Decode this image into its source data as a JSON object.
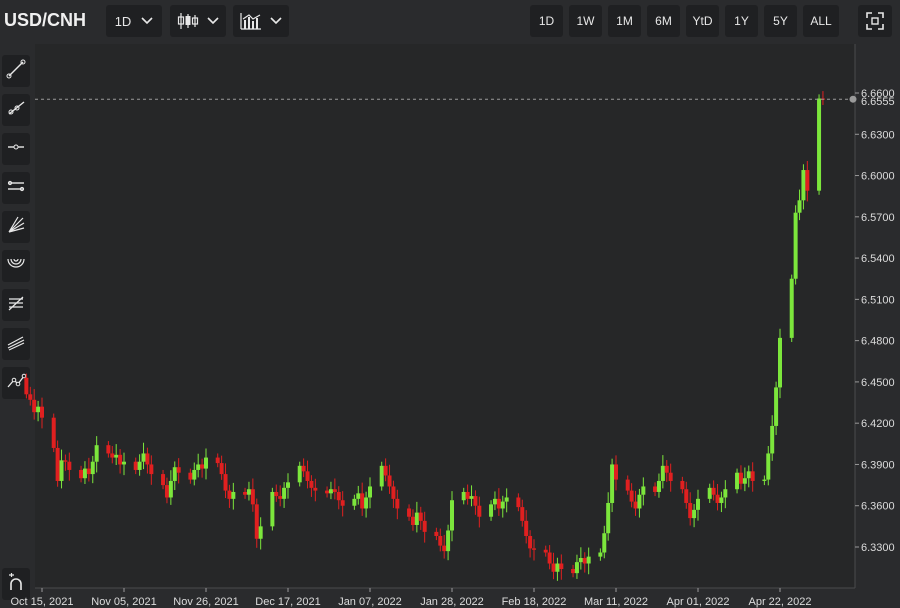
{
  "header": {
    "symbol": "USD/CNH",
    "interval": "1D",
    "ranges": [
      "1D",
      "1W",
      "1M",
      "6M",
      "YtD",
      "1Y",
      "5Y",
      "ALL"
    ]
  },
  "icons": {
    "interval_dropdown": "chevron-down-icon",
    "chart_type": "candlestick-icon",
    "indicators": "indicators-icon",
    "fullscreen": "fullscreen-icon",
    "sidebar": [
      "trend-line-icon",
      "ray-icon",
      "horizontal-line-icon",
      "parallel-channel-icon",
      "fib-fan-icon",
      "fib-arc-icon",
      "fib-retracement-icon",
      "pitchfork-icon",
      "path-icon",
      "magnet-icon"
    ]
  },
  "colors": {
    "background": "#2a2b2d",
    "plot": "#262728",
    "up": "#7ce63c",
    "down": "#e02020",
    "last_price_line": "#9a9a9a"
  },
  "chart_data": {
    "type": "candlestick",
    "symbol": "USD/CNH",
    "interval": "1D",
    "ylim": [
      6.3,
      6.67
    ],
    "y_ticks": [
      "6.6600",
      "6.6300",
      "6.6000",
      "6.5700",
      "6.5400",
      "6.5100",
      "6.4800",
      "6.4500",
      "6.4200",
      "6.3900",
      "6.3600",
      "6.3300"
    ],
    "last_price": "6.6555",
    "x_ticks": [
      {
        "date": "2021-10-15",
        "label": "Oct 15, 2021"
      },
      {
        "date": "2021-11-05",
        "label": "Nov 05, 2021"
      },
      {
        "date": "2021-11-26",
        "label": "Nov 26, 2021"
      },
      {
        "date": "2021-12-17",
        "label": "Dec 17, 2021"
      },
      {
        "date": "2022-01-07",
        "label": "Jan 07, 2022"
      },
      {
        "date": "2022-01-28",
        "label": "Jan 28, 2022"
      },
      {
        "date": "2022-02-18",
        "label": "Feb 18, 2022"
      },
      {
        "date": "2022-03-11",
        "label": "Mar 11, 2022"
      },
      {
        "date": "2022-04-01",
        "label": "Apr 01, 2022"
      },
      {
        "date": "2022-04-22",
        "label": "Apr 22, 2022"
      }
    ],
    "x_range": [
      "2021-10-10",
      "2022-05-08"
    ],
    "closes": [
      [
        "2021-10-11",
        6.441
      ],
      [
        "2021-10-12",
        6.437
      ],
      [
        "2021-10-13",
        6.428
      ],
      [
        "2021-10-14",
        6.432
      ],
      [
        "2021-10-15",
        6.424
      ],
      [
        "2021-10-18",
        6.402
      ],
      [
        "2021-10-19",
        6.378
      ],
      [
        "2021-10-20",
        6.393
      ],
      [
        "2021-10-21",
        6.392
      ],
      [
        "2021-10-22",
        6.386
      ],
      [
        "2021-10-25",
        6.38
      ],
      [
        "2021-10-26",
        6.387
      ],
      [
        "2021-10-27",
        6.383
      ],
      [
        "2021-10-28",
        6.392
      ],
      [
        "2021-10-29",
        6.404
      ],
      [
        "2021-11-01",
        6.398
      ],
      [
        "2021-11-02",
        6.395
      ],
      [
        "2021-11-03",
        6.397
      ],
      [
        "2021-11-04",
        6.39
      ],
      [
        "2021-11-05",
        6.392
      ],
      [
        "2021-11-08",
        6.386
      ],
      [
        "2021-11-09",
        6.392
      ],
      [
        "2021-11-10",
        6.398
      ],
      [
        "2021-11-11",
        6.39
      ],
      [
        "2021-11-12",
        6.383
      ],
      [
        "2021-11-15",
        6.375
      ],
      [
        "2021-11-16",
        6.366
      ],
      [
        "2021-11-17",
        6.378
      ],
      [
        "2021-11-18",
        6.388
      ],
      [
        "2021-11-19",
        6.384
      ],
      [
        "2021-11-22",
        6.379
      ],
      [
        "2021-11-23",
        6.386
      ],
      [
        "2021-11-24",
        6.39
      ],
      [
        "2021-11-25",
        6.387
      ],
      [
        "2021-11-26",
        6.395
      ],
      [
        "2021-11-29",
        6.391
      ],
      [
        "2021-11-30",
        6.383
      ],
      [
        "2021-12-01",
        6.371
      ],
      [
        "2021-12-02",
        6.365
      ],
      [
        "2021-12-03",
        6.37
      ],
      [
        "2021-12-06",
        6.368
      ],
      [
        "2021-12-07",
        6.372
      ],
      [
        "2021-12-08",
        6.361
      ],
      [
        "2021-12-09",
        6.336
      ],
      [
        "2021-12-10",
        6.345
      ],
      [
        "2021-12-13",
        6.37
      ],
      [
        "2021-12-14",
        6.367
      ],
      [
        "2021-12-15",
        6.365
      ],
      [
        "2021-12-16",
        6.373
      ],
      [
        "2021-12-17",
        6.377
      ],
      [
        "2021-12-20",
        6.389
      ],
      [
        "2021-12-21",
        6.385
      ],
      [
        "2021-12-22",
        6.378
      ],
      [
        "2021-12-23",
        6.373
      ],
      [
        "2021-12-24",
        6.371
      ],
      [
        "2021-12-27",
        6.369
      ],
      [
        "2021-12-28",
        6.372
      ],
      [
        "2021-12-29",
        6.37
      ],
      [
        "2021-12-30",
        6.364
      ],
      [
        "2021-12-31",
        6.36
      ],
      [
        "2022-01-03",
        6.365
      ],
      [
        "2022-01-04",
        6.369
      ],
      [
        "2022-01-05",
        6.358
      ],
      [
        "2022-01-06",
        6.366
      ],
      [
        "2022-01-07",
        6.374
      ],
      [
        "2022-01-10",
        6.389
      ],
      [
        "2022-01-11",
        6.382
      ],
      [
        "2022-01-12",
        6.374
      ],
      [
        "2022-01-13",
        6.365
      ],
      [
        "2022-01-14",
        6.358
      ],
      [
        "2022-01-17",
        6.352
      ],
      [
        "2022-01-18",
        6.346
      ],
      [
        "2022-01-19",
        6.355
      ],
      [
        "2022-01-20",
        6.349
      ],
      [
        "2022-01-21",
        6.341
      ],
      [
        "2022-01-24",
        6.338
      ],
      [
        "2022-01-25",
        6.331
      ],
      [
        "2022-01-26",
        6.327
      ],
      [
        "2022-01-27",
        6.342
      ],
      [
        "2022-01-28",
        6.364
      ],
      [
        "2022-01-31",
        6.37
      ],
      [
        "2022-02-01",
        6.365
      ],
      [
        "2022-02-02",
        6.367
      ],
      [
        "2022-02-03",
        6.36
      ],
      [
        "2022-02-04",
        6.352
      ],
      [
        "2022-02-07",
        6.361
      ],
      [
        "2022-02-08",
        6.365
      ],
      [
        "2022-02-09",
        6.358
      ],
      [
        "2022-02-10",
        6.363
      ],
      [
        "2022-02-11",
        6.366
      ],
      [
        "2022-02-14",
        6.359
      ],
      [
        "2022-02-15",
        6.349
      ],
      [
        "2022-02-16",
        6.338
      ],
      [
        "2022-02-17",
        6.329
      ],
      [
        "2022-02-18",
        6.328
      ],
      [
        "2022-02-21",
        6.326
      ],
      [
        "2022-02-22",
        6.318
      ],
      [
        "2022-02-23",
        6.312
      ],
      [
        "2022-02-24",
        6.318
      ],
      [
        "2022-02-25",
        6.314
      ],
      [
        "2022-02-28",
        6.311
      ],
      [
        "2022-03-01",
        6.319
      ],
      [
        "2022-03-02",
        6.322
      ],
      [
        "2022-03-03",
        6.318
      ],
      [
        "2022-03-04",
        6.323
      ],
      [
        "2022-03-07",
        6.326
      ],
      [
        "2022-03-08",
        6.34
      ],
      [
        "2022-03-09",
        6.362
      ],
      [
        "2022-03-10",
        6.39
      ],
      [
        "2022-03-11",
        6.379
      ],
      [
        "2022-03-14",
        6.371
      ],
      [
        "2022-03-15",
        6.363
      ],
      [
        "2022-03-16",
        6.358
      ],
      [
        "2022-03-17",
        6.368
      ],
      [
        "2022-03-18",
        6.374
      ],
      [
        "2022-03-21",
        6.37
      ],
      [
        "2022-03-22",
        6.378
      ],
      [
        "2022-03-23",
        6.389
      ],
      [
        "2022-03-24",
        6.384
      ],
      [
        "2022-03-25",
        6.378
      ],
      [
        "2022-03-28",
        6.372
      ],
      [
        "2022-03-29",
        6.362
      ],
      [
        "2022-03-30",
        6.351
      ],
      [
        "2022-03-31",
        6.357
      ],
      [
        "2022-04-01",
        6.365
      ],
      [
        "2022-04-04",
        6.373
      ],
      [
        "2022-04-05",
        6.368
      ],
      [
        "2022-04-06",
        6.362
      ],
      [
        "2022-04-07",
        6.366
      ],
      [
        "2022-04-08",
        6.372
      ],
      [
        "2022-04-11",
        6.384
      ],
      [
        "2022-04-12",
        6.376
      ],
      [
        "2022-04-13",
        6.38
      ],
      [
        "2022-04-14",
        6.385
      ],
      [
        "2022-04-15",
        6.378
      ],
      [
        "2022-04-18",
        6.379
      ],
      [
        "2022-04-19",
        6.398
      ],
      [
        "2022-04-20",
        6.418
      ],
      [
        "2022-04-21",
        6.446
      ],
      [
        "2022-04-22",
        6.482
      ],
      [
        "2022-04-25",
        6.525
      ],
      [
        "2022-04-26",
        6.573
      ],
      [
        "2022-04-27",
        6.582
      ],
      [
        "2022-04-28",
        6.604
      ],
      [
        "2022-04-29",
        6.589
      ],
      [
        "2022-05-02",
        6.656
      ],
      [
        "2022-05-03",
        6.6555
      ]
    ]
  }
}
